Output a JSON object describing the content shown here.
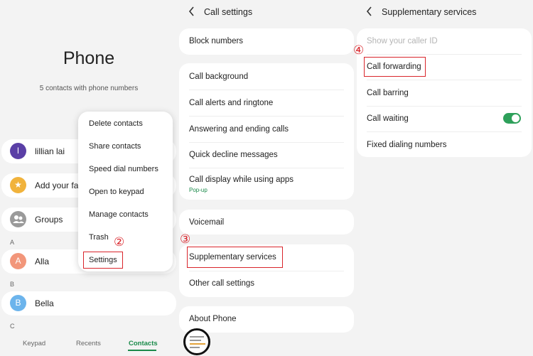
{
  "panel1": {
    "title": "Phone",
    "subtitle": "5 contacts with phone numbers",
    "contacts": [
      {
        "avatar": "l",
        "name": "lillian lai",
        "color": "#5a3fa6"
      },
      {
        "avatar": "★",
        "name": "Add your fa",
        "color": "#f1b33c"
      },
      {
        "avatar": "",
        "name": "Groups",
        "color": "#9a9a9a"
      }
    ],
    "section_a": "A",
    "alla": {
      "avatar": "A",
      "name": "Alla",
      "color": "#f2967a"
    },
    "section_b": "B",
    "bella": {
      "avatar": "B",
      "name": "Bella",
      "color": "#6cb4ec"
    },
    "section_c": "C",
    "tabs": [
      "Keypad",
      "Recents",
      "Contacts"
    ],
    "menu": [
      "Delete contacts",
      "Share contacts",
      "Speed dial numbers",
      "Open to keypad",
      "Manage contacts",
      "Trash",
      "Settings"
    ],
    "step": "②"
  },
  "panel2": {
    "title": "Call settings",
    "block": "Block numbers",
    "group1": [
      "Call background",
      "Call alerts and ringtone",
      "Answering and ending calls",
      "Quick decline messages",
      "Call display while using apps"
    ],
    "popup": "Pop-up",
    "voicemail": "Voicemail",
    "supplementary": "Supplementary services",
    "other": "Other call settings",
    "about": "About Phone",
    "step": "③"
  },
  "panel3": {
    "title": "Supplementary services",
    "items": [
      "Show your caller ID",
      "Call forwarding",
      "Call barring",
      "Call waiting",
      "Fixed dialing numbers"
    ],
    "call_waiting_on": true,
    "step": "④"
  },
  "colors": {
    "accent": "#1a8a4a",
    "highlight": "#d9252b"
  }
}
